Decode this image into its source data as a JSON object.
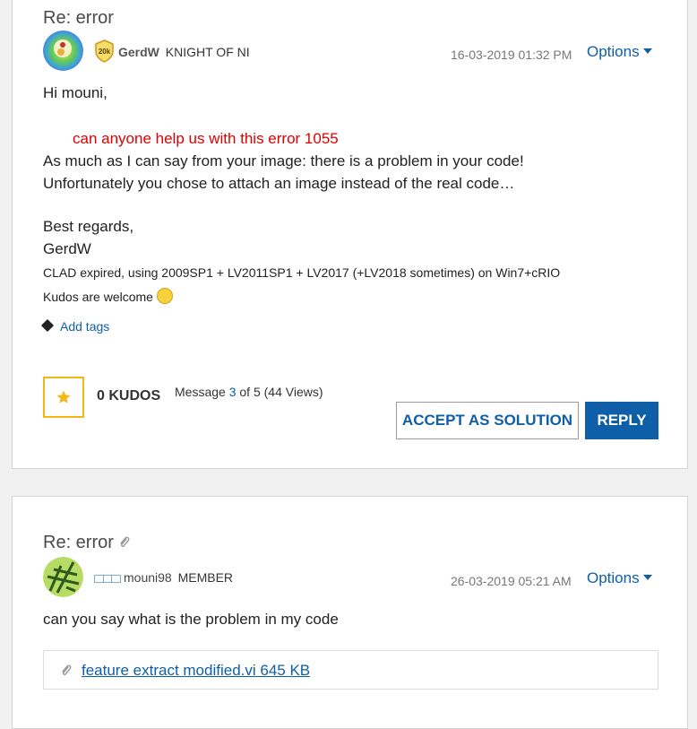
{
  "post1": {
    "subject": "Re: error",
    "author": {
      "name": "GerdW",
      "rank": "KNIGHT OF NI",
      "badge_text": "20k"
    },
    "date": "16-03-2019 01:32 PM",
    "options_label": "Options",
    "greeting": "Hi mouni,",
    "quote": "can anyone help us with this error 1055",
    "body_lines": [
      "As much as I can say from your image: there is a problem in your code!",
      "Unfortunately you chose to attach an image instead of the real code…"
    ],
    "closing": "Best regards,",
    "closing_name": "GerdW",
    "signature_line1": "CLAD expired, using 2009SP1 + LV2011SP1 + LV2017 (+LV2018 sometimes) on Win7+cRIO",
    "signature_line2": "Kudos are welcome",
    "add_tags_label": "Add tags",
    "kudos_label": "0 KUDOS",
    "message_info": {
      "prefix": "Message ",
      "number": "3",
      "suffix": " of 5 (44 Views)"
    },
    "accept_label": "ACCEPT AS SOLUTION",
    "reply_label": "REPLY"
  },
  "post2": {
    "subject": "Re: error",
    "author": {
      "name": "mouni98",
      "rank": "MEMBER"
    },
    "date": "26-03-2019 05:21 AM",
    "options_label": "Options",
    "body": "can you say what is the problem in my code",
    "attachment": "feature extract modified.vi 645 KB"
  },
  "colors": {
    "link": "#0f5fa8",
    "quote_red": "#e00000",
    "kudo_gold": "#f5b617"
  }
}
